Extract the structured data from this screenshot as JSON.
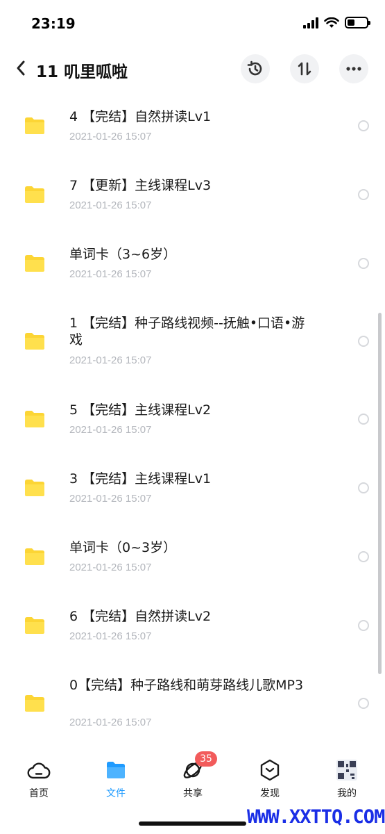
{
  "status_bar": {
    "time": "23:19"
  },
  "header": {
    "title": "11 叽里呱啦"
  },
  "files": [
    {
      "name": "4 【完结】自然拼读Lv1",
      "date": "2021-01-26 15:07"
    },
    {
      "name": "7 【更新】主线课程Lv3",
      "date": "2021-01-26 15:07"
    },
    {
      "name": "单词卡（3~6岁）",
      "date": "2021-01-26 15:07"
    },
    {
      "name": "1 【完结】种子路线视频--抚触•口语•游戏",
      "date": "2021-01-26 15:07"
    },
    {
      "name": "5 【完结】主线课程Lv2",
      "date": "2021-01-26 15:07"
    },
    {
      "name": "3 【完结】主线课程Lv1",
      "date": "2021-01-26 15:07"
    },
    {
      "name": "单词卡（0~3岁）",
      "date": "2021-01-26 15:07"
    },
    {
      "name": "6 【完结】自然拼读Lv2",
      "date": "2021-01-26 15:07"
    },
    {
      "name": "0【完结】种子路线和萌芽路线儿歌MP3",
      "date": "2021-01-26 15:07"
    }
  ],
  "tab_bar": {
    "tabs": [
      {
        "label": "首页",
        "icon": "cloud-icon"
      },
      {
        "label": "文件",
        "icon": "folder-icon",
        "active": true
      },
      {
        "label": "共享",
        "icon": "orbit-icon",
        "badge": "35"
      },
      {
        "label": "发现",
        "icon": "discover-icon"
      },
      {
        "label": "我的",
        "icon": "qr-avatar-icon"
      }
    ]
  },
  "watermark": "WWW.XXTTQ.COM",
  "colors": {
    "accent": "#1f9bff",
    "folder": "#fcd535",
    "badge": "#f25b5b",
    "date": "#b3b6bc"
  }
}
